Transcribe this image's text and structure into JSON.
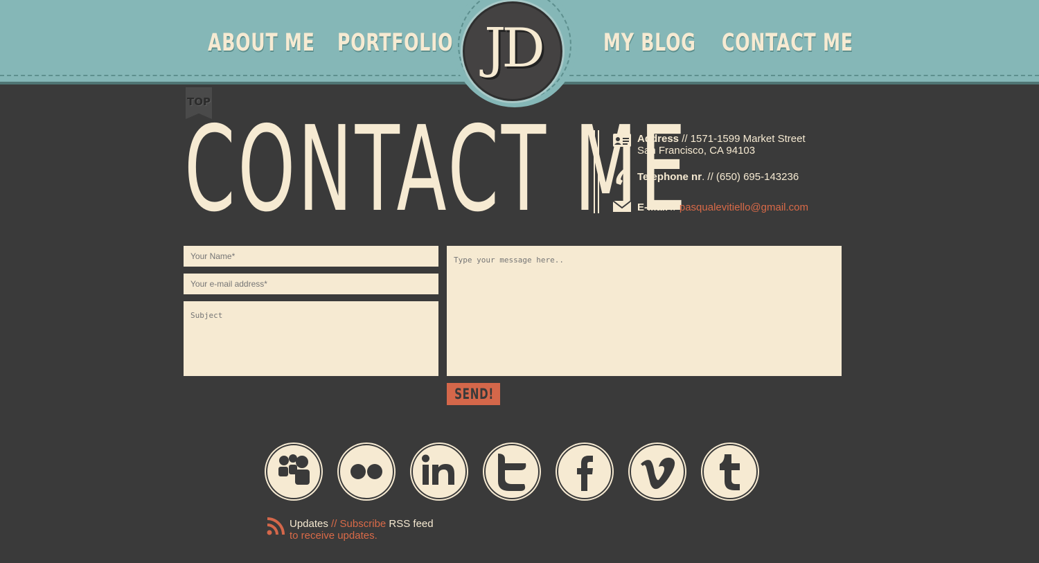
{
  "nav": {
    "about": "ABOUT ME",
    "portfolio": "PORTFOLIO",
    "blog": "MY BLOG",
    "contact": "CONTACT ME"
  },
  "logo": {
    "text": "JD"
  },
  "top_ribbon": {
    "label": "TOP"
  },
  "page": {
    "title": "CONTACT ME"
  },
  "contact_info": {
    "address_label": "Address",
    "address_sep": " // ",
    "address_line1": "1571-1599 Market Street",
    "address_line2": "San Francisco, CA 94103",
    "phone_label": "Telephone nr",
    "phone_sep": ". // ",
    "phone_value": "(650) 695-143236",
    "email_label": "E-Mail",
    "email_sep": " // ",
    "email_value": "pasqualevitiello@gmail.com"
  },
  "form": {
    "name_placeholder": "Your Name*",
    "email_placeholder": "Your e-mail address*",
    "subject_placeholder": "Subject",
    "message_placeholder": "Type your message here..",
    "send_label": "SEND!"
  },
  "social": {
    "items": [
      "myspace-icon",
      "flickr-icon",
      "linkedin-icon",
      "twitter-icon",
      "facebook-icon",
      "vimeo-icon",
      "tumblr-icon"
    ]
  },
  "rss": {
    "updates": "Updates",
    "sep": " // ",
    "subscribe": "Subscribe",
    "feed": " RSS feed",
    "line2": "to receive updates."
  },
  "colors": {
    "header_teal": "#85b7b7",
    "background": "#3a3a3a",
    "cream": "#f6ead2",
    "accent": "#d4674a"
  }
}
